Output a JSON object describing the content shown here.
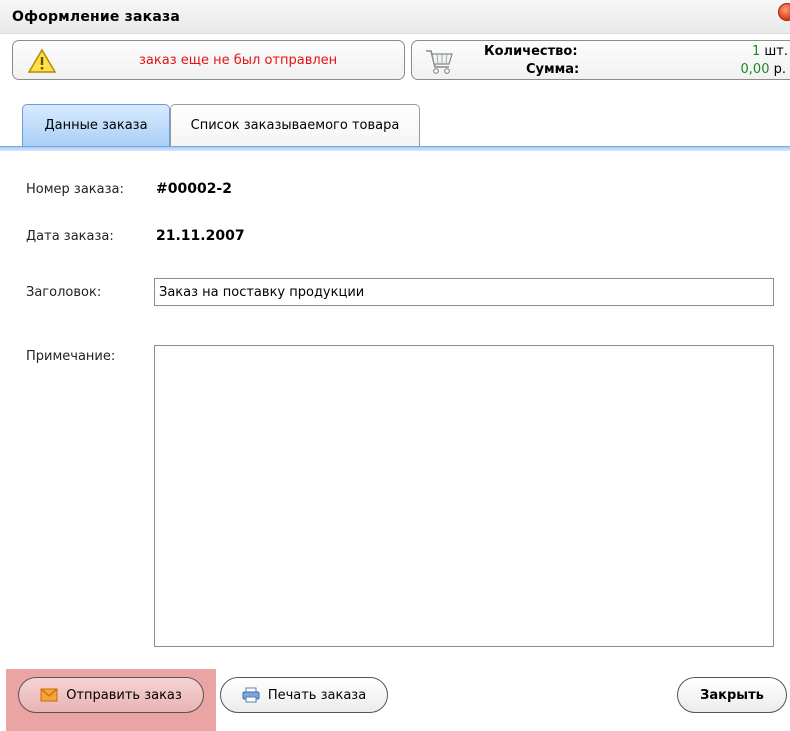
{
  "window": {
    "title": "Оформление заказа"
  },
  "status": {
    "message": "заказ еще не был отправлен"
  },
  "summary": {
    "quantity_label": "Количество:",
    "quantity_value": "1",
    "quantity_unit": " шт.",
    "total_label": "Сумма:",
    "total_value": "0,00",
    "total_unit": " р."
  },
  "tabs": [
    {
      "label": "Данные заказа",
      "active": true
    },
    {
      "label": "Список заказываемого товара",
      "active": false
    }
  ],
  "form": {
    "order_number_label": "Номер заказа:",
    "order_number_value": "#00002-2",
    "order_date_label": "Дата заказа:",
    "order_date_value": "21.11.2007",
    "title_label": "Заголовок:",
    "title_value": "Заказ на поставку продукции",
    "notes_label": "Примечание:",
    "notes_value": ""
  },
  "buttons": {
    "send": "Отправить заказ",
    "print": "Печать заказа",
    "close": "Закрыть"
  },
  "icons": {
    "warning": "warning-icon",
    "cart": "shopping-cart-icon",
    "envelope": "envelope-icon",
    "printer": "printer-icon"
  },
  "colors": {
    "status_text": "#e31212",
    "value_green": "#1f8a1f",
    "active_tab": "#a9cff7",
    "send_highlight": "#eba4a4"
  }
}
